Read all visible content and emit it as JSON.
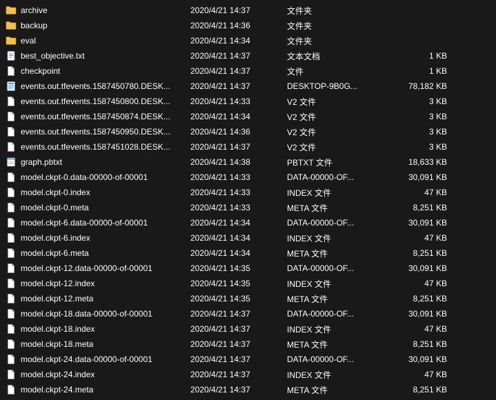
{
  "files": [
    {
      "icon": "folder",
      "name": "archive",
      "date": "2020/4/21 14:37",
      "type": "文件夹",
      "size": ""
    },
    {
      "icon": "folder",
      "name": "backup",
      "date": "2020/4/21 14:36",
      "type": "文件夹",
      "size": ""
    },
    {
      "icon": "folder",
      "name": "eval",
      "date": "2020/4/21 14:34",
      "type": "文件夹",
      "size": ""
    },
    {
      "icon": "textdoc",
      "name": "best_objective.txt",
      "date": "2020/4/21 14:37",
      "type": "文本文档",
      "size": "1 KB"
    },
    {
      "icon": "file",
      "name": "checkpoint",
      "date": "2020/4/21 14:37",
      "type": "文件",
      "size": "1 KB"
    },
    {
      "icon": "event",
      "name": "events.out.tfevents.1587450780.DESK...",
      "date": "2020/4/21 14:37",
      "type": "DESKTOP-9B0G...",
      "size": "78,182 KB"
    },
    {
      "icon": "file",
      "name": "events.out.tfevents.1587450800.DESK...",
      "date": "2020/4/21 14:33",
      "type": "V2 文件",
      "size": "3 KB"
    },
    {
      "icon": "file",
      "name": "events.out.tfevents.1587450874.DESK...",
      "date": "2020/4/21 14:34",
      "type": "V2 文件",
      "size": "3 KB"
    },
    {
      "icon": "file",
      "name": "events.out.tfevents.1587450950.DESK...",
      "date": "2020/4/21 14:36",
      "type": "V2 文件",
      "size": "3 KB"
    },
    {
      "icon": "file",
      "name": "events.out.tfevents.1587451028.DESK...",
      "date": "2020/4/21 14:37",
      "type": "V2 文件",
      "size": "3 KB"
    },
    {
      "icon": "notepad",
      "name": "graph.pbtxt",
      "date": "2020/4/21 14:38",
      "type": "PBTXT 文件",
      "size": "18,633 KB"
    },
    {
      "icon": "file",
      "name": "model.ckpt-0.data-00000-of-00001",
      "date": "2020/4/21 14:33",
      "type": "DATA-00000-OF...",
      "size": "30,091 KB"
    },
    {
      "icon": "file",
      "name": "model.ckpt-0.index",
      "date": "2020/4/21 14:33",
      "type": "INDEX 文件",
      "size": "47 KB"
    },
    {
      "icon": "file",
      "name": "model.ckpt-0.meta",
      "date": "2020/4/21 14:33",
      "type": "META 文件",
      "size": "8,251 KB"
    },
    {
      "icon": "file",
      "name": "model.ckpt-6.data-00000-of-00001",
      "date": "2020/4/21 14:34",
      "type": "DATA-00000-OF...",
      "size": "30,091 KB"
    },
    {
      "icon": "file",
      "name": "model.ckpt-6.index",
      "date": "2020/4/21 14:34",
      "type": "INDEX 文件",
      "size": "47 KB"
    },
    {
      "icon": "file",
      "name": "model.ckpt-6.meta",
      "date": "2020/4/21 14:34",
      "type": "META 文件",
      "size": "8,251 KB"
    },
    {
      "icon": "file",
      "name": "model.ckpt-12.data-00000-of-00001",
      "date": "2020/4/21 14:35",
      "type": "DATA-00000-OF...",
      "size": "30,091 KB"
    },
    {
      "icon": "file",
      "name": "model.ckpt-12.index",
      "date": "2020/4/21 14:35",
      "type": "INDEX 文件",
      "size": "47 KB"
    },
    {
      "icon": "file",
      "name": "model.ckpt-12.meta",
      "date": "2020/4/21 14:35",
      "type": "META 文件",
      "size": "8,251 KB"
    },
    {
      "icon": "file",
      "name": "model.ckpt-18.data-00000-of-00001",
      "date": "2020/4/21 14:37",
      "type": "DATA-00000-OF...",
      "size": "30,091 KB"
    },
    {
      "icon": "file",
      "name": "model.ckpt-18.index",
      "date": "2020/4/21 14:37",
      "type": "INDEX 文件",
      "size": "47 KB"
    },
    {
      "icon": "file",
      "name": "model.ckpt-18.meta",
      "date": "2020/4/21 14:37",
      "type": "META 文件",
      "size": "8,251 KB"
    },
    {
      "icon": "file",
      "name": "model.ckpt-24.data-00000-of-00001",
      "date": "2020/4/21 14:37",
      "type": "DATA-00000-OF...",
      "size": "30,091 KB"
    },
    {
      "icon": "file",
      "name": "model.ckpt-24.index",
      "date": "2020/4/21 14:37",
      "type": "INDEX 文件",
      "size": "47 KB"
    },
    {
      "icon": "file",
      "name": "model.ckpt-24.meta",
      "date": "2020/4/21 14:37",
      "type": "META 文件",
      "size": "8,251 KB"
    }
  ]
}
